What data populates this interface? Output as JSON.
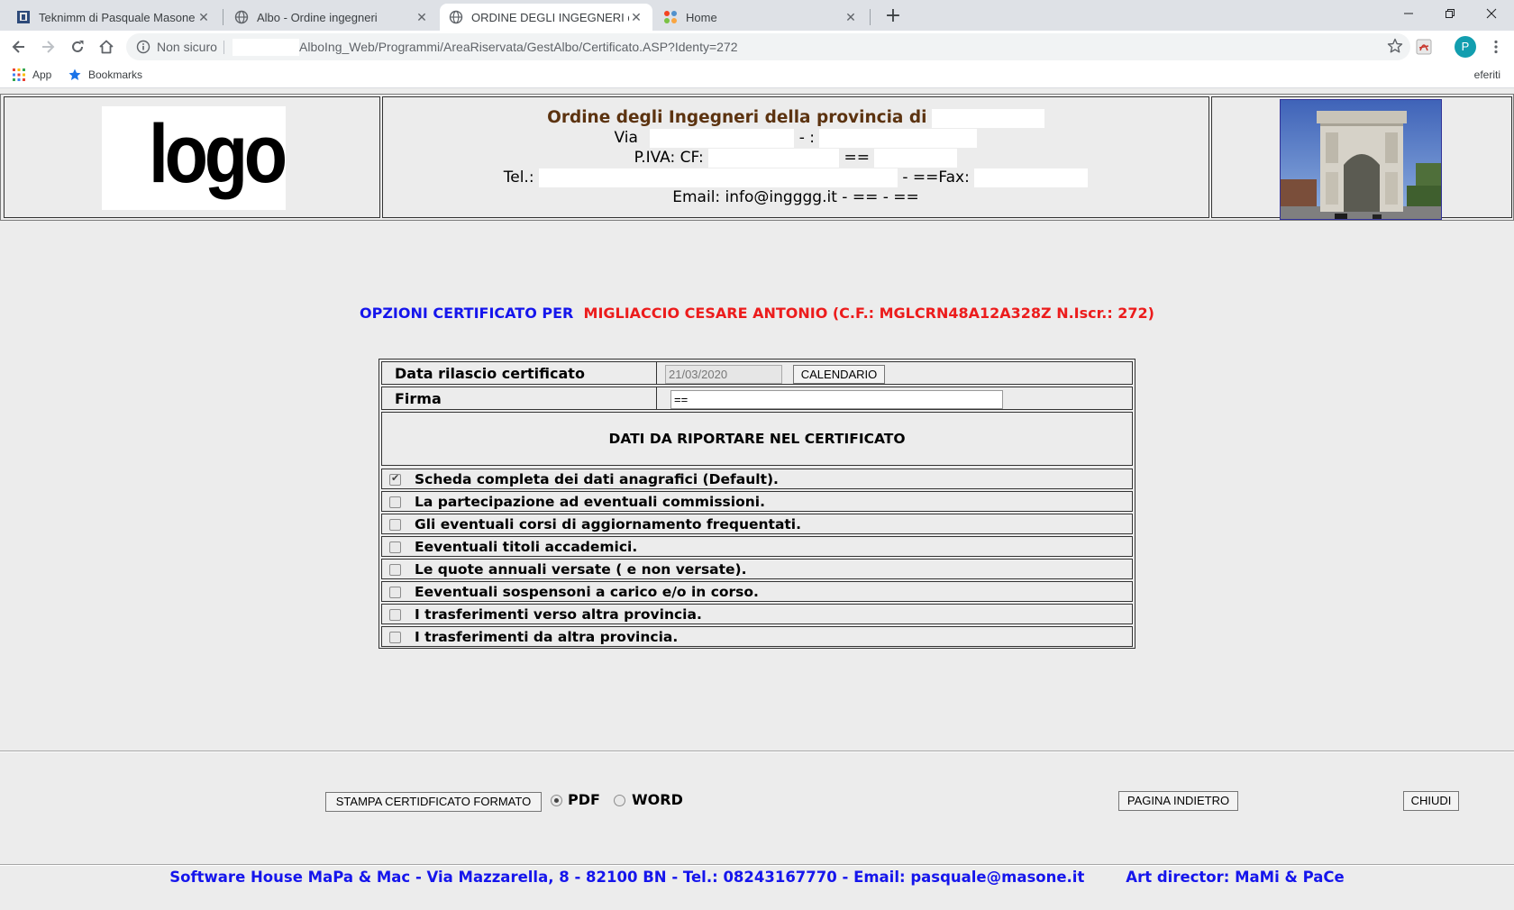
{
  "browser": {
    "tabs": [
      {
        "title": "Teknimm di Pasquale Masone",
        "favicon": "site-favicon",
        "active": false
      },
      {
        "title": "Albo - Ordine ingegneri",
        "favicon": "globe-icon",
        "active": false
      },
      {
        "title": "ORDINE DEGLI INGEGNERI di",
        "favicon": "globe-icon",
        "active": true
      },
      {
        "title": "Home",
        "favicon": "joomla-icon",
        "active": false
      }
    ],
    "new_tab_label": "+",
    "security_label": "Non sicuro",
    "url": "AlboIng_Web/Programmi/AreaRiservata/GestAlbo/Certificato.ASP?Identy=272",
    "profile_initial": "P",
    "bookmarks": [
      {
        "label": "App",
        "icon": "apps-grid-icon"
      },
      {
        "label": "Bookmarks",
        "icon": "star-icon"
      }
    ],
    "bookmarks_overflow": "eferiti"
  },
  "header": {
    "logo_text": "logo",
    "org_title": "Ordine degli Ingegneri della provincia di",
    "via_label": "Via",
    "via_sep": "- :",
    "piva_label": "P.IVA: CF:",
    "piva_sep": "==",
    "tel_label": "Tel.:",
    "fax_label": "- ==Fax:",
    "email_line": "Email: info@ingggg.it - == - =="
  },
  "options_title": {
    "prefix": "OPZIONI CERTIFICATO PER",
    "person": "MIGLIACCIO CESARE ANTONIO (C.F.: MGLCRN48A12A328Z N.Iscr.: 272)"
  },
  "form": {
    "date_label": "Data rilascio certificato",
    "date_value": "21/03/2020",
    "calendar_button": "CALENDARIO",
    "firma_label": "Firma",
    "firma_value": "==",
    "section_title": "DATI DA RIPORTARE NEL CERTIFICATO",
    "options": [
      {
        "label": "Scheda completa dei dati anagrafici (Default).",
        "checked": true
      },
      {
        "label": "La partecipazione ad eventuali commissioni.",
        "checked": false
      },
      {
        "label": "Gli eventuali corsi di aggiornamento frequentati.",
        "checked": false
      },
      {
        "label": "Eeventuali titoli accademici.",
        "checked": false
      },
      {
        "label": "Le quote annuali versate ( e non versate).",
        "checked": false
      },
      {
        "label": "Eeventuali sospensoni a carico e/o in corso.",
        "checked": false
      },
      {
        "label": "I trasferimenti verso altra provincia.",
        "checked": false
      },
      {
        "label": "I trasferimenti da altra provincia.",
        "checked": false
      }
    ]
  },
  "actions": {
    "print_button": "STAMPA CERTIDFICATO FORMATO",
    "format_pdf": "PDF",
    "format_word": "WORD",
    "selected_format": "PDF",
    "back_button": "PAGINA INDIETRO",
    "close_button": "CHIUDI"
  },
  "footer": {
    "text": "Software House MaPa & Mac - Via Mazzarella, 8 - 82100 BN - Tel.: 08243167770 - Email: pasquale@masone.it        Art director: MaMi & PaCe"
  },
  "colors": {
    "blue_text": "#1515ec",
    "red_text": "#ec1c1c",
    "org_title": "#5c3310",
    "page_bg": "#ececec"
  }
}
